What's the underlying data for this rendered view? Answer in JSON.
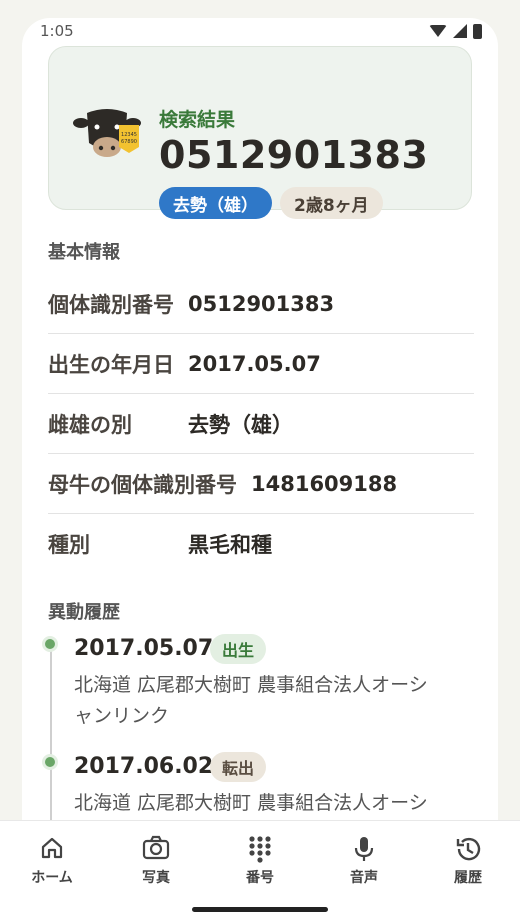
{
  "status_bar": {
    "time": "1:05"
  },
  "result_card": {
    "label": "検索結果",
    "id_number": "0512901383",
    "sex_chip": "去勢（雄）",
    "age_chip": "2歳8ヶ月",
    "cow_icon": "cow-icon",
    "ear_tag_text": [
      "12345",
      "67890"
    ]
  },
  "basic_info": {
    "title": "基本情報",
    "rows": [
      {
        "label": "個体識別番号",
        "value": "0512901383"
      },
      {
        "label": "出生の年月日",
        "value": "2017.05.07"
      },
      {
        "label": "雌雄の別",
        "value": "去勢（雄）"
      },
      {
        "label": "母牛の個体識別番号",
        "value": "1481609188"
      },
      {
        "label": "種別",
        "value": "黒毛和種"
      }
    ]
  },
  "history": {
    "title": "異動履歴",
    "items": [
      {
        "date": "2017.05.07",
        "type": "出生",
        "address_line1": "北海道 広尾郡大樹町 農事組合法人オーシ",
        "address_line2": "ャンリンク"
      },
      {
        "date": "2017.06.02",
        "type": "転出",
        "address_line1": "北海道 広尾郡大樹町 農事組合法人オーシ",
        "address_line2": ""
      }
    ]
  },
  "bottom_nav": {
    "items": [
      {
        "label": "ホーム",
        "icon": "home-icon"
      },
      {
        "label": "写真",
        "icon": "camera-icon"
      },
      {
        "label": "番号",
        "icon": "keypad-icon"
      },
      {
        "label": "音声",
        "icon": "microphone-icon"
      },
      {
        "label": "履歴",
        "icon": "history-icon"
      }
    ]
  },
  "colors": {
    "accent_green": "#3a7a3a",
    "sex_chip_blue": "#2f78c8",
    "timeline_dot": "#6aa667"
  }
}
